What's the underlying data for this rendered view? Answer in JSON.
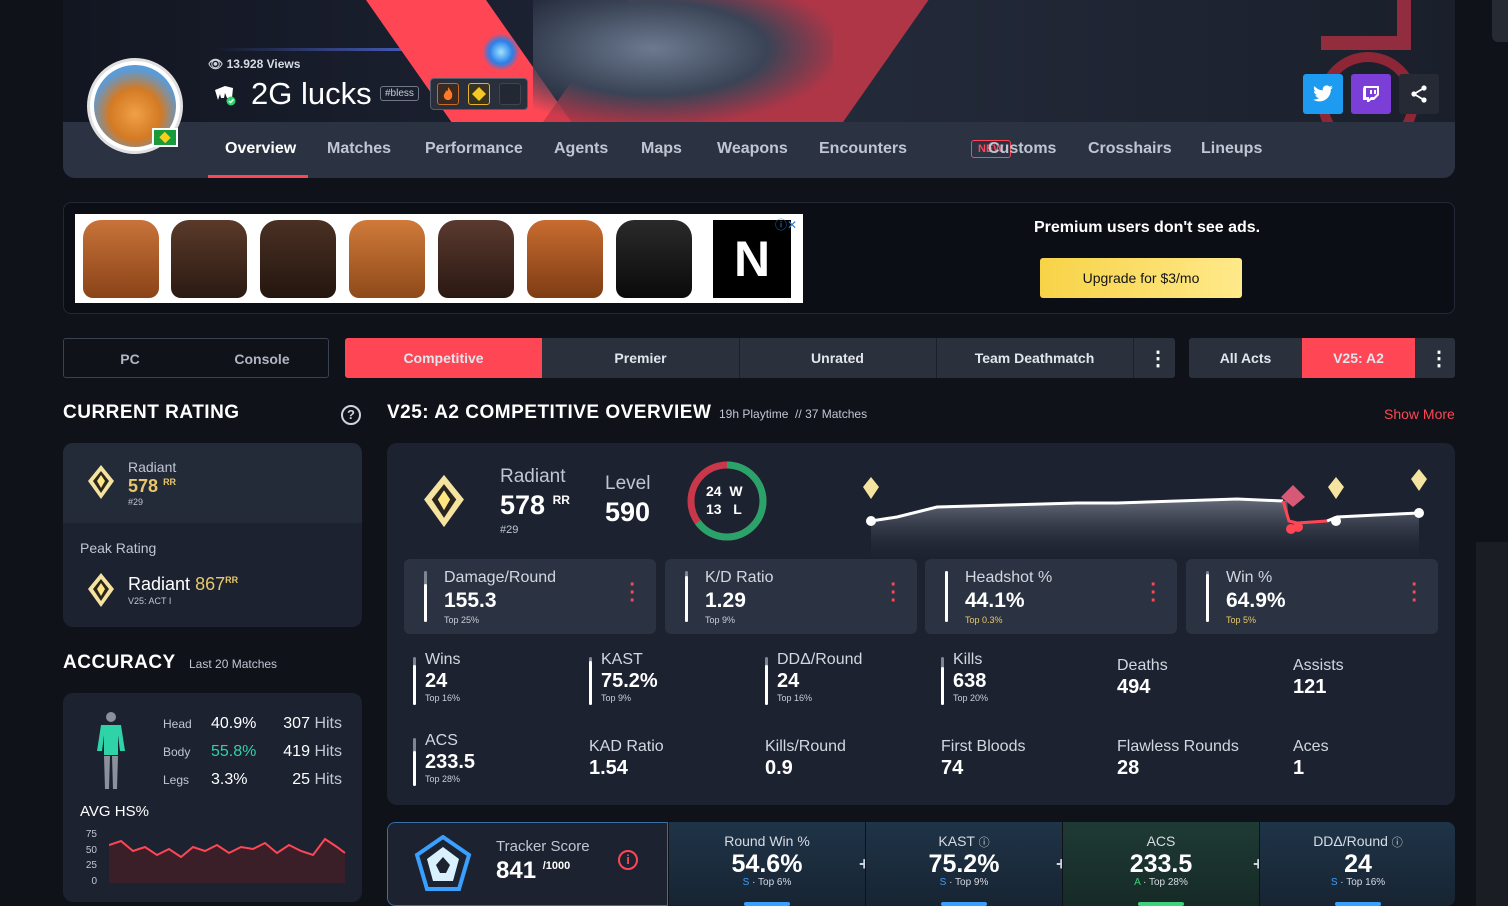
{
  "profile": {
    "views": "13.928 Views",
    "name": "2G lucks",
    "tag": "#bless"
  },
  "nav": {
    "items": [
      "Overview",
      "Matches",
      "Performance",
      "Agents",
      "Maps",
      "Weapons",
      "Encounters",
      "Customs",
      "Crosshairs",
      "Lineups"
    ],
    "new_badge": "NEW",
    "active": "Overview"
  },
  "social": {
    "twitter_icon": "twitter-icon",
    "twitch_icon": "twitch-icon",
    "share_icon": "share-icon"
  },
  "ad": {
    "premium_text": "Premium users don't see ads.",
    "upgrade_label": "Upgrade for $3/mo",
    "logo_letter": "N"
  },
  "filters": {
    "platform": [
      "PC",
      "Console"
    ],
    "modes": [
      "Competitive",
      "Premier",
      "Unrated",
      "Team Deathmatch"
    ],
    "active_mode": "Competitive",
    "acts": [
      "All Acts",
      "V25: A2"
    ],
    "active_act": "V25: A2"
  },
  "rating": {
    "title": "CURRENT RATING",
    "rank": "Radiant",
    "rr": "578",
    "rr_unit": "RR",
    "position": "#29",
    "peak_label": "Peak Rating",
    "peak_rank": "Radiant",
    "peak_rr": "867",
    "peak_act": "V25: ACT I"
  },
  "accuracy": {
    "title": "ACCURACY",
    "subtitle": "Last 20 Matches",
    "rows": [
      {
        "part": "Head",
        "pct": "40.9%",
        "hits": "307",
        "hits_label": "Hits"
      },
      {
        "part": "Body",
        "pct": "55.8%",
        "hits": "419",
        "hits_label": "Hits"
      },
      {
        "part": "Legs",
        "pct": "3.3%",
        "hits": "25",
        "hits_label": "Hits"
      }
    ],
    "avg_label": "AVG HS%",
    "y_ticks": [
      "75",
      "50",
      "25",
      "0"
    ],
    "colors": {
      "body": "#2ed3a8",
      "line": "#ff4655"
    }
  },
  "overview": {
    "title": "V25: A2 COMPETITIVE OVERVIEW",
    "playtime": "19h Playtime",
    "divider": "//",
    "matches": "37 Matches",
    "show_more": "Show More",
    "rank": "Radiant",
    "rr": "578",
    "rr_unit": "RR",
    "position": "#29",
    "level_label": "Level",
    "level": "590",
    "wins": "24",
    "w": "W",
    "losses": "13",
    "l": "L",
    "win_fraction": 0.649
  },
  "main_stats": [
    {
      "label": "Damage/Round",
      "value": "155.3",
      "rank": "Top 25%",
      "percentile": 0.75,
      "rank_color": "#c9ced8"
    },
    {
      "label": "K/D Ratio",
      "value": "1.29",
      "rank": "Top 9%",
      "percentile": 0.91,
      "rank_color": "#c9ced8"
    },
    {
      "label": "Headshot %",
      "value": "44.1%",
      "rank": "Top 0.3%",
      "percentile": 0.997,
      "rank_color": "#e8c76a"
    },
    {
      "label": "Win %",
      "value": "64.9%",
      "rank": "Top 5%",
      "percentile": 0.95,
      "rank_color": "#e8c76a"
    }
  ],
  "sub_stats": [
    {
      "label": "Wins",
      "value": "24",
      "rank": "Top 16%",
      "percentile": 0.84
    },
    {
      "label": "KAST",
      "value": "75.2%",
      "rank": "Top 9%",
      "percentile": 0.91
    },
    {
      "label": "DDΔ/Round",
      "value": "24",
      "rank": "Top 16%",
      "percentile": 0.84
    },
    {
      "label": "Kills",
      "value": "638",
      "rank": "Top 20%",
      "percentile": 0.8
    },
    {
      "label": "Deaths",
      "value": "494"
    },
    {
      "label": "Assists",
      "value": "121"
    },
    {
      "label": "ACS",
      "value": "233.5",
      "rank": "Top 28%",
      "percentile": 0.72
    },
    {
      "label": "KAD Ratio",
      "value": "1.54"
    },
    {
      "label": "Kills/Round",
      "value": "0.9"
    },
    {
      "label": "First Bloods",
      "value": "74"
    },
    {
      "label": "Flawless Rounds",
      "value": "28"
    },
    {
      "label": "Aces",
      "value": "1"
    }
  ],
  "tracker": {
    "label": "Tracker Score",
    "score": "841",
    "max": "/1000",
    "cells": [
      {
        "label": "Round Win %",
        "value": "54.6%",
        "grade": "S",
        "rank": "Top 6%",
        "color": "#3aa0ff"
      },
      {
        "label": "KAST",
        "value": "75.2%",
        "grade": "S",
        "rank": "Top 9%",
        "color": "#3aa0ff",
        "info": true
      },
      {
        "label": "ACS",
        "value": "233.5",
        "grade": "A",
        "rank": "Top 28%",
        "color": "#3fd17c"
      },
      {
        "label": "DDΔ/Round",
        "value": "24",
        "grade": "S",
        "rank": "Top 16%",
        "color": "#3aa0ff",
        "info": true
      }
    ]
  }
}
